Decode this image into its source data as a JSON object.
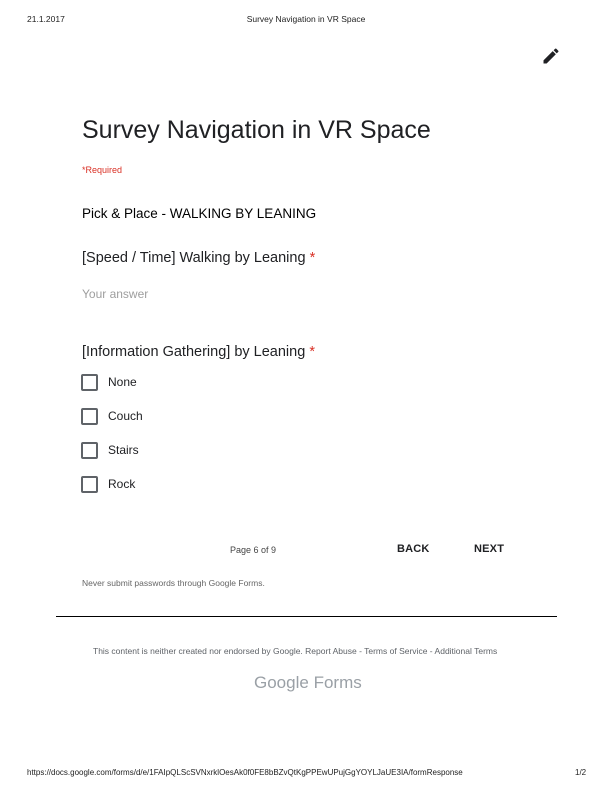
{
  "print_header": {
    "date": "21.1.2017",
    "doc_title": "Survey Navigation in VR Space"
  },
  "form": {
    "title": "Survey Navigation in VR Space",
    "required_note": "*Required",
    "section_title": "Pick & Place - WALKING BY LEANING",
    "question1": {
      "title": "[Speed / Time] Walking by Leaning",
      "required_star": "*",
      "placeholder": "Your answer",
      "value": ""
    },
    "question2": {
      "title": "[Information Gathering] by Leaning",
      "required_star": "*",
      "options": [
        "None",
        "Couch",
        "Stairs",
        "Rock"
      ]
    }
  },
  "navigation": {
    "page_indicator": "Page 6 of 9",
    "back_label": "BACK",
    "next_label": "NEXT"
  },
  "password_warning": "Never submit passwords through Google Forms.",
  "footer": {
    "disclaimer_prefix": "This content is neither created nor endorsed by Google.",
    "report_abuse": "Report Abuse",
    "sep1": "-",
    "terms_of_service": "Terms of Service",
    "sep2": "-",
    "additional_terms": "Additional Terms",
    "logo_google": "Google",
    "logo_forms": "Forms"
  },
  "print_footer": {
    "url": "https://docs.google.com/forms/d/e/1FAIpQLScSVNxrklOesAk0f0FE8bBZvQtKgPPEwUPujGgYOYLJaUE3IA/formResponse",
    "page": "1/2"
  },
  "icons": {
    "edit": "pencil-icon",
    "checkbox": "checkbox-unchecked-icon"
  },
  "colors": {
    "required_red": "#d93025",
    "text_dark": "#202124",
    "muted_gray": "#9aa0a6"
  }
}
